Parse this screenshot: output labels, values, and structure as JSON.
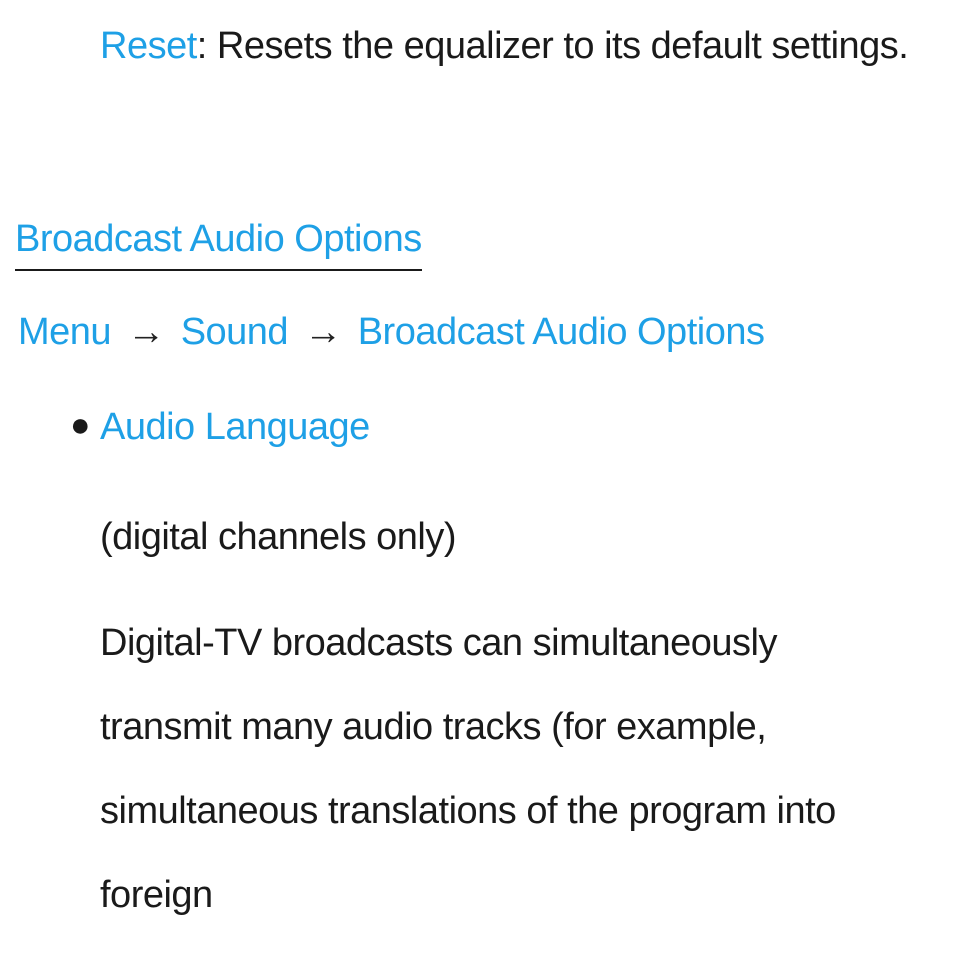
{
  "reset": {
    "term": "Reset",
    "desc": ": Resets the equalizer to its default settings."
  },
  "section": {
    "heading": "Broadcast Audio Options",
    "breadcrumb": {
      "menu": "Menu",
      "sound": "Sound",
      "bao": "Broadcast Audio Options"
    }
  },
  "item": {
    "label": "Audio Language",
    "note": "(digital channels only)",
    "body": "Digital-TV broadcasts can simultaneously transmit many audio tracks (for example, simultaneous translations of the program into foreign"
  }
}
